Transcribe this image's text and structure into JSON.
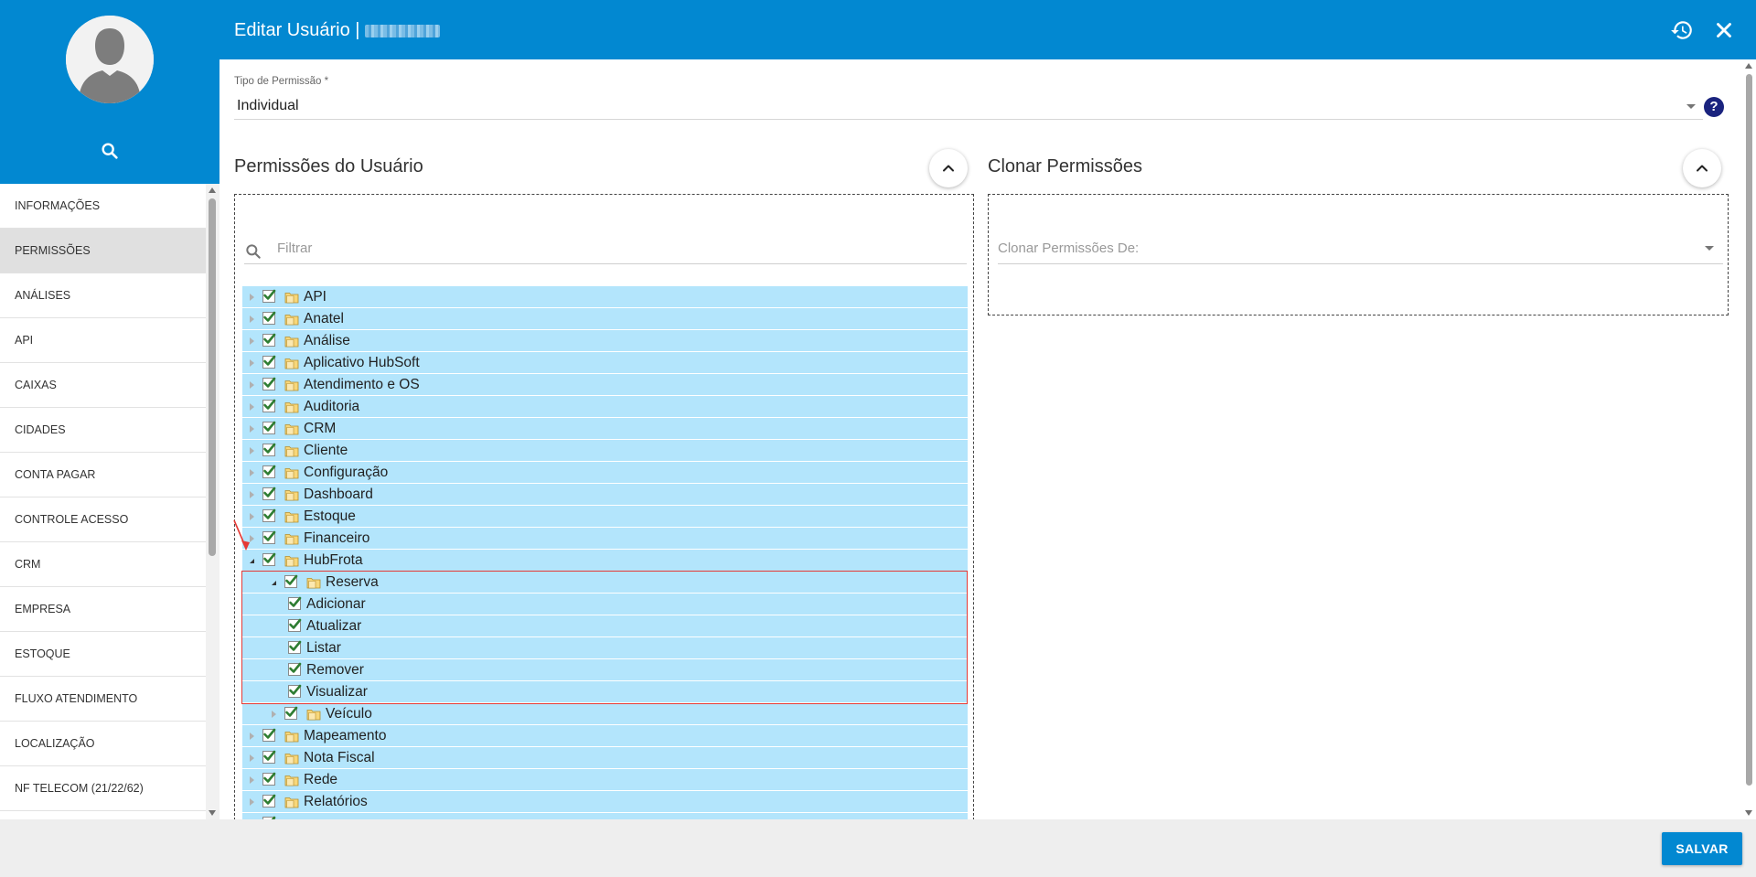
{
  "header": {
    "title": "Editar Usuário |"
  },
  "sidebar": {
    "items": [
      {
        "label": "INFORMAÇÕES"
      },
      {
        "label": "PERMISSÕES"
      },
      {
        "label": "ANÁLISES"
      },
      {
        "label": "API"
      },
      {
        "label": "CAIXAS"
      },
      {
        "label": "CIDADES"
      },
      {
        "label": "CONTA PAGAR"
      },
      {
        "label": "CONTROLE ACESSO"
      },
      {
        "label": "CRM"
      },
      {
        "label": "EMPRESA"
      },
      {
        "label": "ESTOQUE"
      },
      {
        "label": "FLUXO ATENDIMENTO"
      },
      {
        "label": "LOCALIZAÇÃO"
      },
      {
        "label": "NF TELECOM (21/22/62)"
      },
      {
        "label": ""
      }
    ],
    "active_item": "PERMISSÕES"
  },
  "permission_type": {
    "label": "Tipo de Permissão *",
    "value": "Individual"
  },
  "user_permissions": {
    "title": "Permissões do Usuário",
    "filter_placeholder": "Filtrar",
    "tree": [
      {
        "label": "API",
        "level": 0,
        "state": "collapsed",
        "folder": true
      },
      {
        "label": "Anatel",
        "level": 0,
        "state": "collapsed",
        "folder": true
      },
      {
        "label": "Análise",
        "level": 0,
        "state": "collapsed",
        "folder": true
      },
      {
        "label": "Aplicativo HubSoft",
        "level": 0,
        "state": "collapsed",
        "folder": true
      },
      {
        "label": "Atendimento e OS",
        "level": 0,
        "state": "collapsed",
        "folder": true
      },
      {
        "label": "Auditoria",
        "level": 0,
        "state": "collapsed",
        "folder": true
      },
      {
        "label": "CRM",
        "level": 0,
        "state": "collapsed",
        "folder": true
      },
      {
        "label": "Cliente",
        "level": 0,
        "state": "collapsed",
        "folder": true
      },
      {
        "label": "Configuração",
        "level": 0,
        "state": "collapsed",
        "folder": true
      },
      {
        "label": "Dashboard",
        "level": 0,
        "state": "collapsed",
        "folder": true
      },
      {
        "label": "Estoque",
        "level": 0,
        "state": "collapsed",
        "folder": true
      },
      {
        "label": "Financeiro",
        "level": 0,
        "state": "collapsed",
        "folder": true
      },
      {
        "label": "HubFrota",
        "level": 0,
        "state": "expanded",
        "folder": true
      },
      {
        "label": "Reserva",
        "level": 1,
        "state": "expanded",
        "folder": true
      },
      {
        "label": "Adicionar",
        "level": 2,
        "state": "leaf",
        "folder": false
      },
      {
        "label": "Atualizar",
        "level": 2,
        "state": "leaf",
        "folder": false
      },
      {
        "label": "Listar",
        "level": 2,
        "state": "leaf",
        "folder": false
      },
      {
        "label": "Remover",
        "level": 2,
        "state": "leaf",
        "folder": false
      },
      {
        "label": "Visualizar",
        "level": 2,
        "state": "leaf",
        "folder": false
      },
      {
        "label": "Veículo",
        "level": 1,
        "state": "collapsed",
        "folder": true
      },
      {
        "label": "Mapeamento",
        "level": 0,
        "state": "collapsed",
        "folder": true
      },
      {
        "label": "Nota Fiscal",
        "level": 0,
        "state": "collapsed",
        "folder": true
      },
      {
        "label": "Rede",
        "level": 0,
        "state": "collapsed",
        "folder": true
      },
      {
        "label": "Relatórios",
        "level": 0,
        "state": "collapsed",
        "folder": true
      },
      {
        "label": "",
        "level": 0,
        "state": "collapsed",
        "folder": true
      }
    ]
  },
  "clone_permissions": {
    "title": "Clonar Permissões",
    "placeholder": "Clonar Permissões De:"
  },
  "footer": {
    "save_label": "SALVAR"
  },
  "icons": {
    "history": "history-icon",
    "close": "close-icon",
    "help": "?",
    "search": "search-icon",
    "collapse": "chevron-up-icon"
  },
  "colors": {
    "primary": "#0288d1",
    "tree_row": "#b3e5fc",
    "highlight": "#e53935",
    "check": "#2e7d32"
  }
}
